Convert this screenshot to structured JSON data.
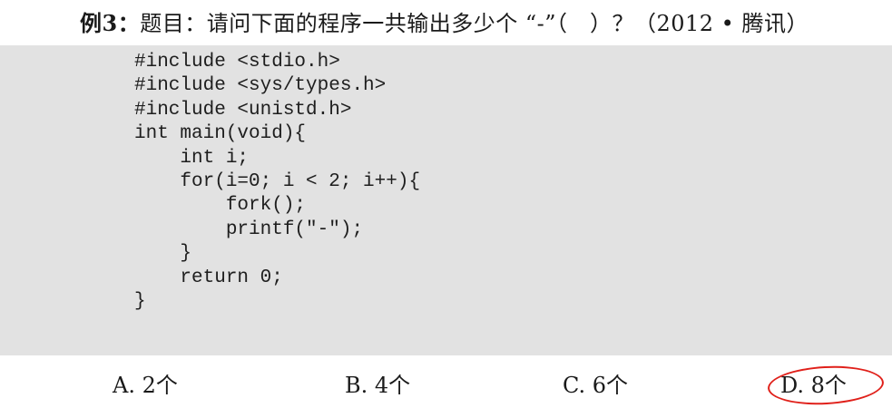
{
  "question": {
    "label": "例3：",
    "text": "题目：请问下面的程序一共输出多少个 “-”（　）？（2012 • 腾讯）"
  },
  "code": {
    "lines": [
      "#include <stdio.h>",
      "#include <sys/types.h>",
      "#include <unistd.h>",
      "int main(void){",
      "    int i;",
      "    for(i=0; i < 2; i++){",
      "        fork();",
      "        printf(\"-\");",
      "    }",
      "    return 0;",
      "}"
    ]
  },
  "options": [
    {
      "text": "A. 2个"
    },
    {
      "text": "B. 4个"
    },
    {
      "text": "C. 6个"
    },
    {
      "text": "D. 8个"
    }
  ],
  "highlight": {
    "marked_option": "D",
    "circle_color": "#e0201a"
  }
}
